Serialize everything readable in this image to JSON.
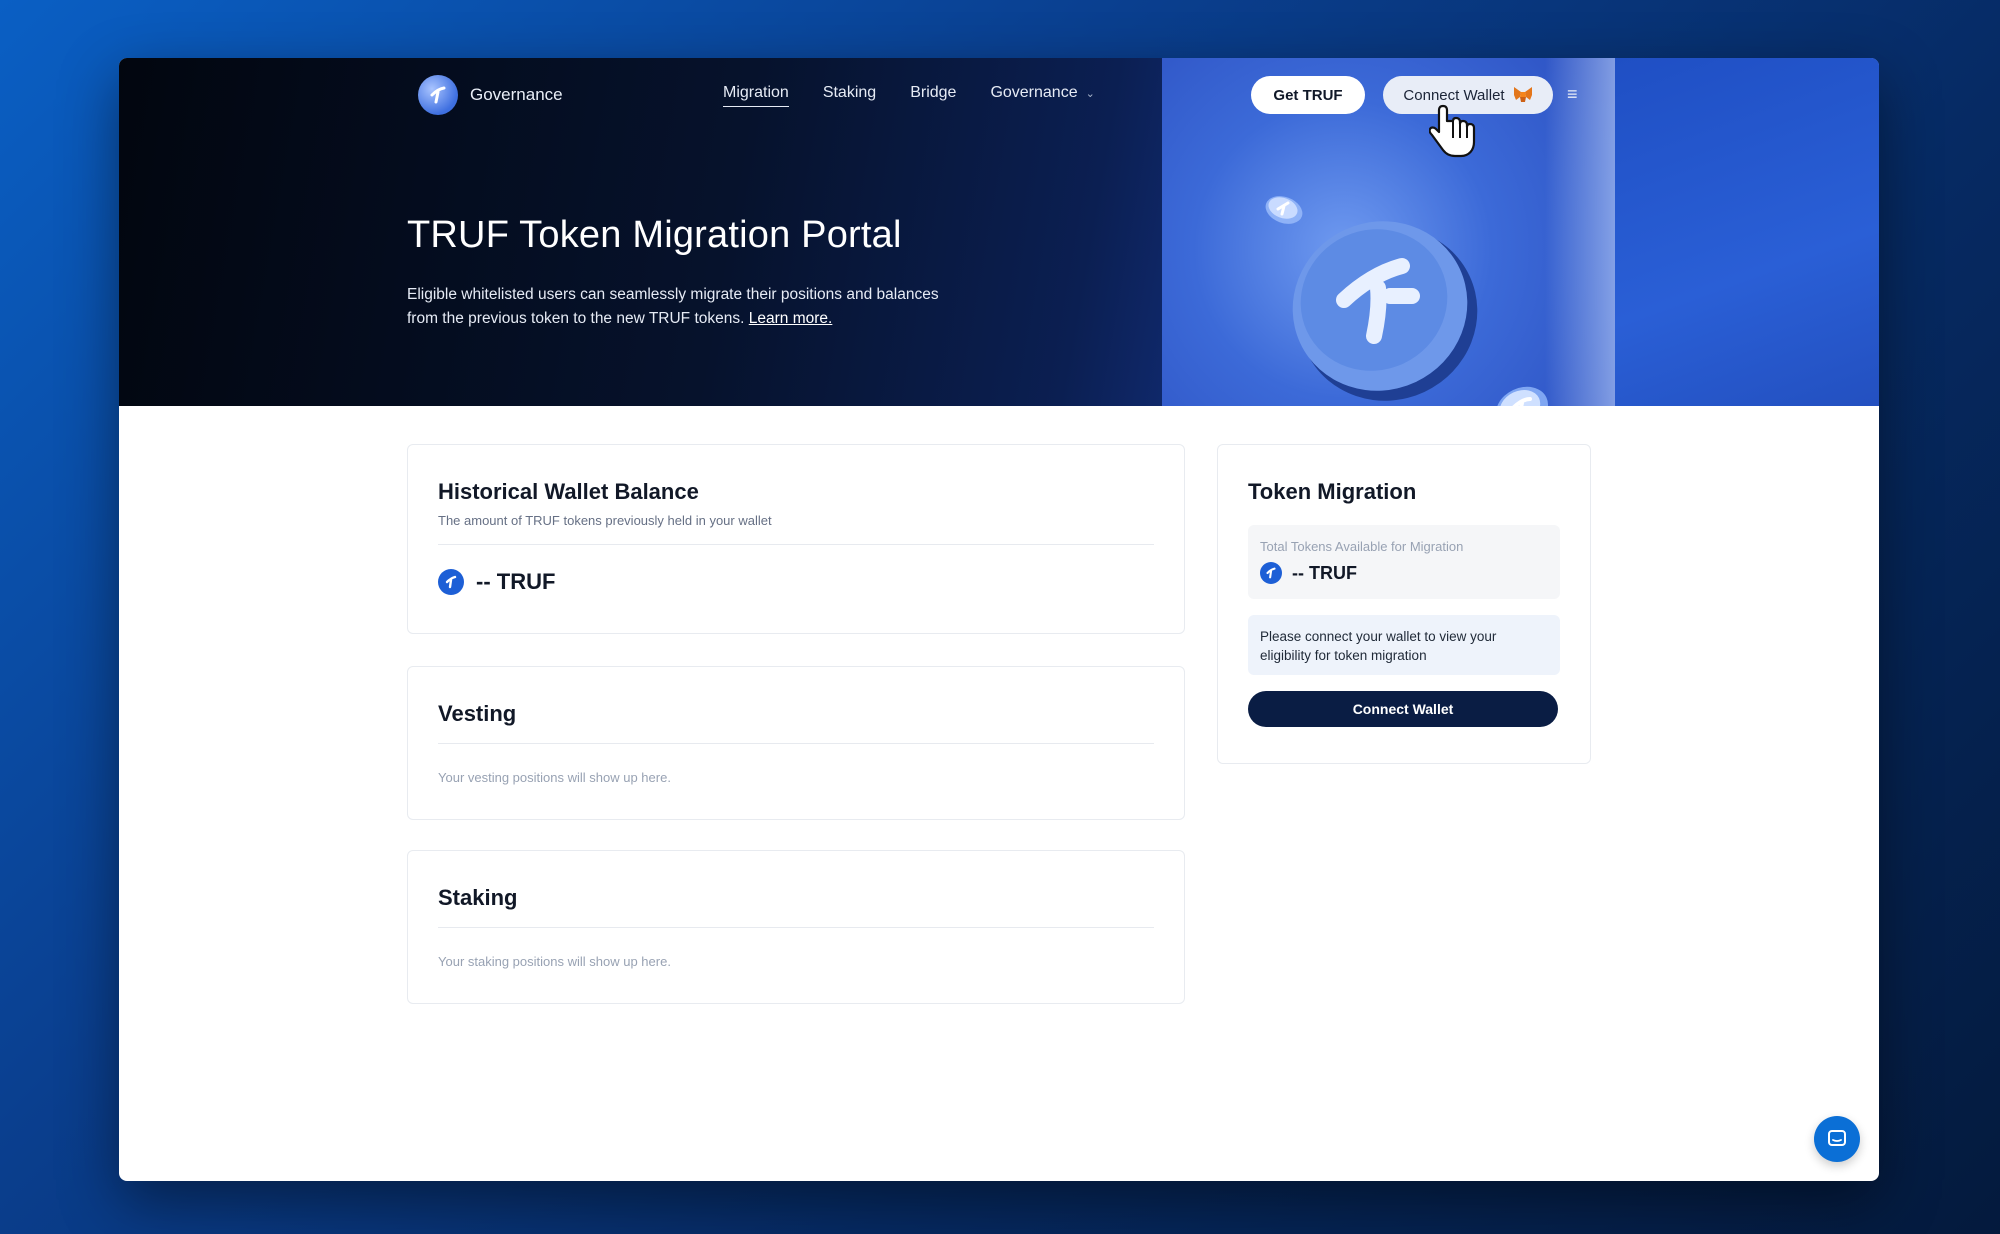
{
  "header": {
    "logo_label": "Governance",
    "nav": [
      {
        "label": "Migration",
        "active": true
      },
      {
        "label": "Staking",
        "active": false
      },
      {
        "label": "Bridge",
        "active": false
      },
      {
        "label": "Governance",
        "active": false,
        "has_dropdown": true
      }
    ],
    "get_truf_label": "Get TRUF",
    "connect_wallet_label": "Connect Wallet",
    "menu_icon": "hamburger-icon"
  },
  "hero": {
    "title": "TRUF Token Migration Portal",
    "description": "Eligible whitelisted users can seamlessly migrate their positions and balances from the previous token to the new TRUF tokens.",
    "learn_more": "Learn more."
  },
  "historical": {
    "title": "Historical Wallet Balance",
    "subtitle": "The amount of TRUF tokens previously held in your wallet",
    "amount": "-- TRUF"
  },
  "vesting": {
    "title": "Vesting",
    "empty": "Your vesting positions will show up here."
  },
  "staking": {
    "title": "Staking",
    "empty": "Your staking positions will show up here."
  },
  "migration": {
    "title": "Token Migration",
    "available_label": "Total Tokens Available for Migration",
    "available_amount": "-- TRUF",
    "notice": "Please connect your wallet to view your eligibility for token migration",
    "connect_label": "Connect Wallet"
  },
  "colors": {
    "accent": "#1d5fd6",
    "primary_button": "#0a1d44",
    "chat_button": "#0b6fd6"
  }
}
